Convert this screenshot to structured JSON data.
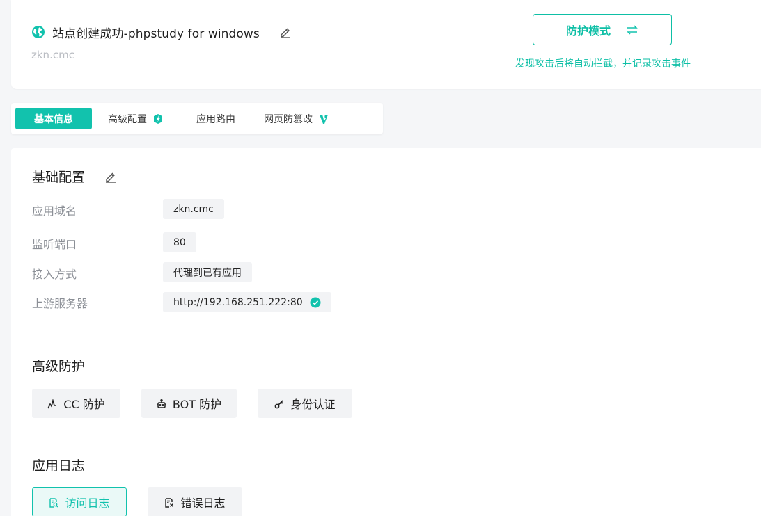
{
  "header": {
    "site_title": "站点创建成功-phpstudy for windows",
    "site_domain": "zkn.cmc",
    "mode_button_label": "防护模式",
    "mode_description": "发现攻击后将自动拦截，并记录攻击事件"
  },
  "tabs": [
    {
      "label": "基本信息",
      "active": true
    },
    {
      "label": "高级配置",
      "active": false
    },
    {
      "label": "应用路由",
      "active": false
    },
    {
      "label": "网页防篡改",
      "active": false
    }
  ],
  "basic_config": {
    "title": "基础配置",
    "fields": [
      {
        "label": "应用域名",
        "value": "zkn.cmc"
      },
      {
        "label": "监听端口",
        "value": "80"
      },
      {
        "label": "接入方式",
        "value": "代理到已有应用"
      },
      {
        "label": "上游服务器",
        "value": "http://192.168.251.222:80"
      }
    ]
  },
  "advanced_protection": {
    "title": "高级防护",
    "buttons": [
      {
        "label": "CC 防护",
        "icon": "pulse-icon"
      },
      {
        "label": "BOT 防护",
        "icon": "robot-icon"
      },
      {
        "label": "身份认证",
        "icon": "key-icon"
      }
    ]
  },
  "app_logs": {
    "title": "应用日志",
    "buttons": [
      {
        "label": "访问日志",
        "icon": "access-log-icon",
        "selected": true
      },
      {
        "label": "错误日志",
        "icon": "error-log-icon",
        "selected": false
      }
    ]
  },
  "colors": {
    "accent": "#12c2ad",
    "muted_text": "#8b8f96",
    "field_bg": "#f2f3f5"
  }
}
